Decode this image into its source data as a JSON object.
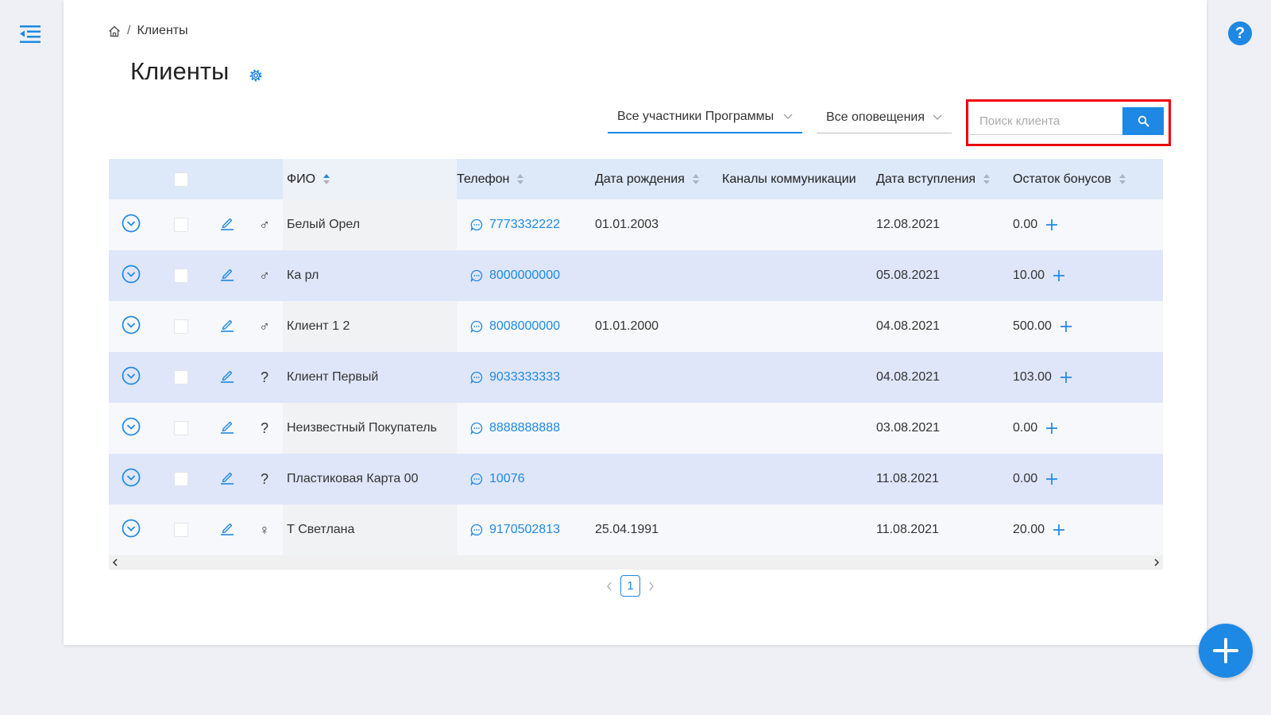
{
  "breadcrumb": {
    "home_icon": "home-icon",
    "current": "Клиенты"
  },
  "page": {
    "title": "Клиенты",
    "settings_icon": "gear-icon"
  },
  "filters": {
    "participants": "Все участники Программы",
    "notifications": "Все оповещения"
  },
  "search": {
    "placeholder": "Поиск клиента",
    "icon": "search-icon"
  },
  "table": {
    "columns": {
      "fio": "ФИО",
      "phone": "Телефон",
      "birthdate": "Дата рождения",
      "channels": "Каналы коммуникации",
      "join_date": "Дата вступления",
      "balance": "Остаток бонусов"
    },
    "rows": [
      {
        "gender": "♂",
        "name": "Белый Орел",
        "phone": "7773332222",
        "birthdate": "01.01.2003",
        "channels": "",
        "join_date": "12.08.2021",
        "balance": "0.00"
      },
      {
        "gender": "♂",
        "name": "Ка рл",
        "phone": "8000000000",
        "birthdate": "",
        "channels": "",
        "join_date": "05.08.2021",
        "balance": "10.00"
      },
      {
        "gender": "♂",
        "name": "Клиент 1 2",
        "phone": "8008000000",
        "birthdate": "01.01.2000",
        "channels": "",
        "join_date": "04.08.2021",
        "balance": "500.00"
      },
      {
        "gender": "?",
        "name": "Клиент Первый",
        "phone": "9033333333",
        "birthdate": "",
        "channels": "",
        "join_date": "04.08.2021",
        "balance": "103.00"
      },
      {
        "gender": "?",
        "name": "Неизвестный Покупатель",
        "phone": "8888888888",
        "birthdate": "",
        "channels": "",
        "join_date": "03.08.2021",
        "balance": "0.00"
      },
      {
        "gender": "?",
        "name": "Пластиковая Карта 00",
        "phone": "10076",
        "birthdate": "",
        "channels": "",
        "join_date": "11.08.2021",
        "balance": "0.00"
      },
      {
        "gender": "♀",
        "name": "Т Светлана",
        "phone": "9170502813",
        "birthdate": "25.04.1991",
        "channels": "",
        "join_date": "11.08.2021",
        "balance": "20.00"
      }
    ]
  },
  "pagination": {
    "current_page": "1"
  },
  "colors": {
    "accent": "#1e88e5",
    "highlight_outline": "#e00000",
    "row_alt": "#dfe6f9"
  }
}
